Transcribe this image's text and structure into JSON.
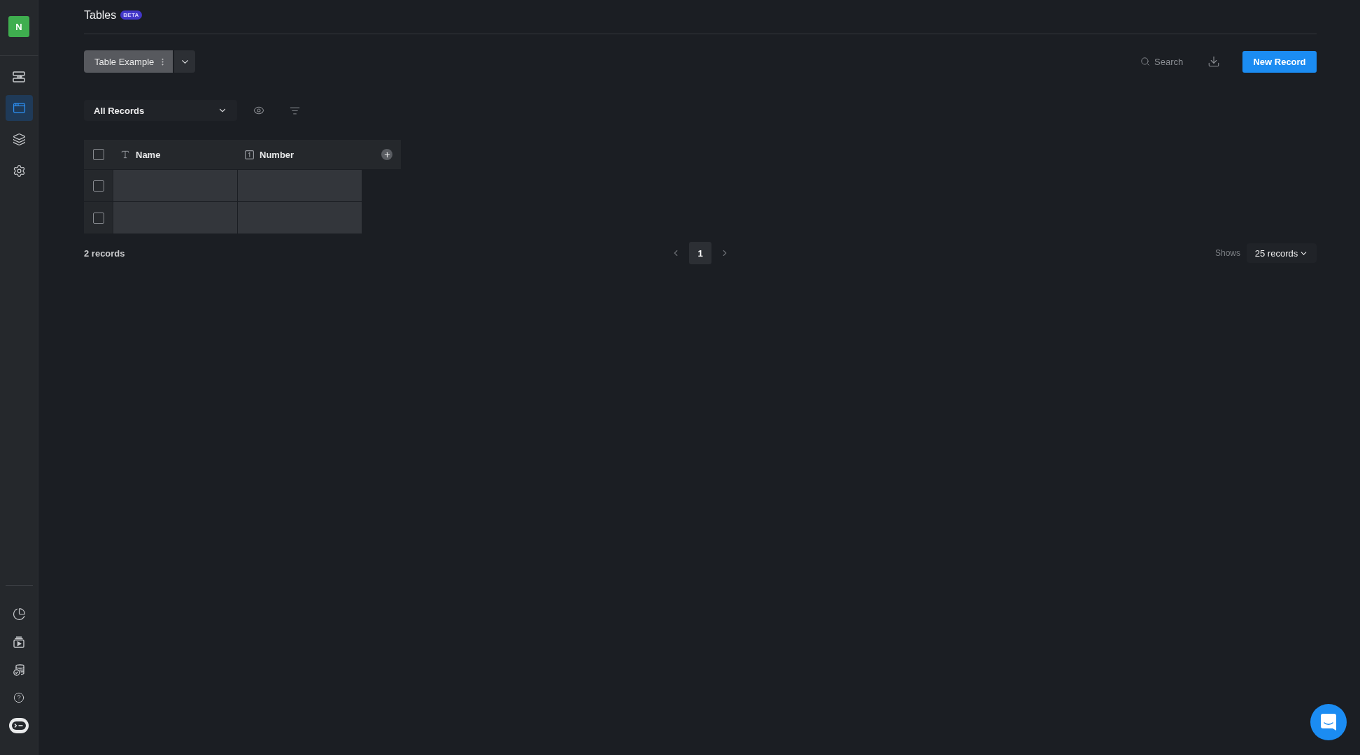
{
  "sidebar": {
    "logo": "N",
    "top_items": [
      {
        "selected": false
      },
      {
        "selected": true
      },
      {
        "selected": false
      },
      {
        "selected": false
      }
    ]
  },
  "header": {
    "title": "Tables",
    "badge": "BETA"
  },
  "toolbar": {
    "table_tab": "Table Example",
    "search": {
      "placeholder": "Search"
    },
    "new_button": "New Record"
  },
  "view_bar": {
    "view": "All Records"
  },
  "table": {
    "all_selected": false,
    "columns": [
      {
        "name": "Name",
        "kind": "text"
      },
      {
        "name": "Number",
        "kind": "number"
      }
    ],
    "rows": [
      {
        "selected": false
      },
      {
        "selected": false
      }
    ]
  },
  "footer": {
    "count": "2 records",
    "pages": [
      {
        "label": "1",
        "selected": true
      }
    ],
    "page_size_label": "Shows",
    "page_size": "25 records"
  }
}
